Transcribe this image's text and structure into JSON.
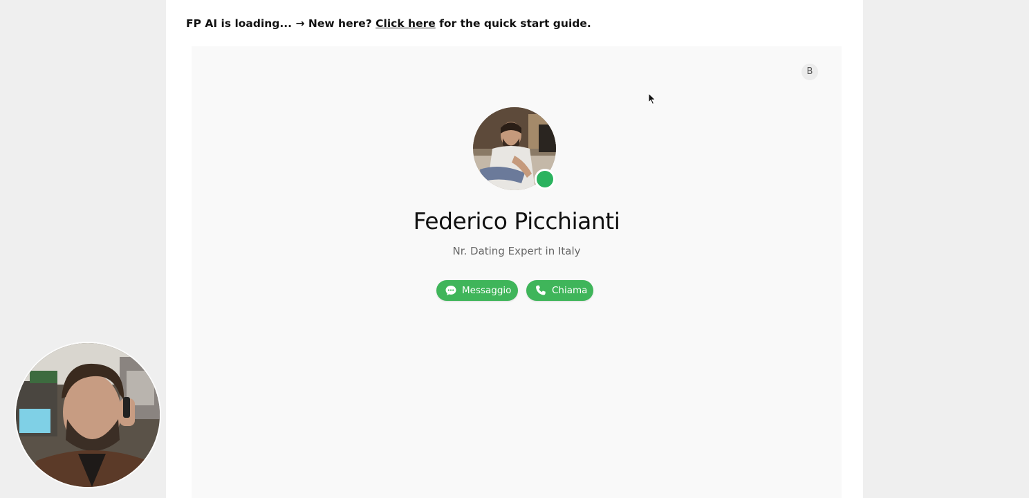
{
  "banner": {
    "prefix": "FP AI is loading... → New here? ",
    "link_text": "Click here",
    "suffix": " for the quick start guide."
  },
  "profile": {
    "badge": "B",
    "name": "Federico Picchianti",
    "subtitle": "Nr. Dating Expert in Italy",
    "online": true,
    "status_color": "#2bb35f"
  },
  "actions": {
    "message_label": "Messaggio",
    "message_icon": "chat-bubble-icon",
    "call_label": "Chiama",
    "call_icon": "phone-icon",
    "accent": "#3fb55a"
  },
  "webcam": {
    "icon": "webcam-overlay"
  }
}
